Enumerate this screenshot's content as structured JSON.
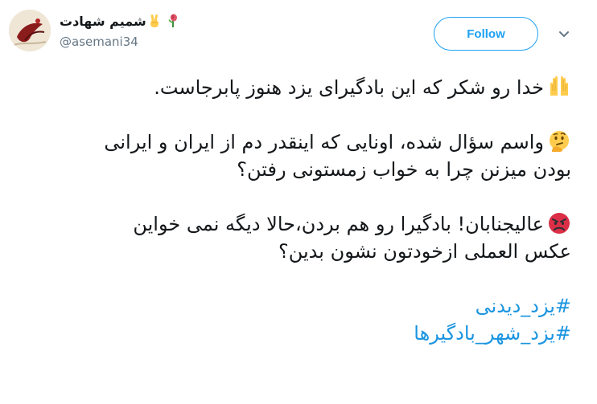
{
  "user": {
    "display_name": "شمیم شهادت",
    "handle": "@asemani34",
    "badge_icons": [
      "victory-hand-icon",
      "wilted-flower-icon"
    ]
  },
  "actions": {
    "follow_label": "Follow",
    "more_icon": "chevron-down-icon"
  },
  "tweet": {
    "line1": "خدا رو شکر که این بادگیرای یزد هنوز پابرجاست.",
    "line1_icon": "raising-hands-icon",
    "line2": "واسم سؤال شده، اونایی که اینقدر دم از ایران و ایرانی",
    "line2_icon": "thinking-face-icon",
    "line3": "بودن میزنن چرا به خواب زمستونی رفتن؟",
    "line4": "عالیجنابان! بادگیرا رو هم بردن،حالا دیگه نمی خواین",
    "line4_icon": "angry-face-icon",
    "line5": "عکس العملی ازخودتون نشون بدین؟",
    "hashtags": [
      "#یزد_دیدنی",
      "#یزد_شهر_بادگیرها"
    ]
  },
  "colors": {
    "accent": "#1da1f2",
    "hashtag": "#1b95e0",
    "text": "#14171a",
    "muted": "#657786"
  }
}
